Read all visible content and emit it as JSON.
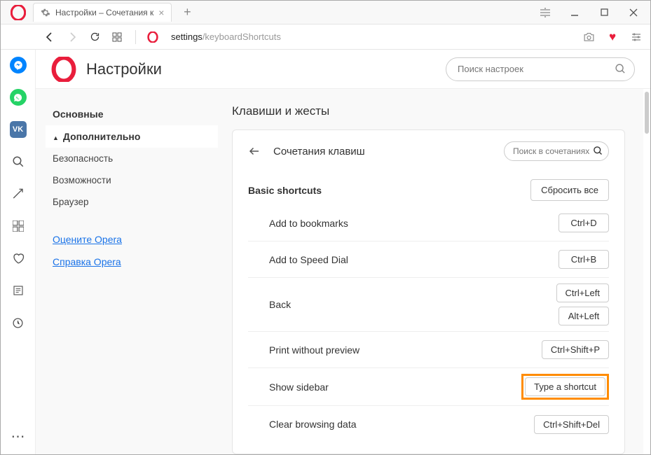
{
  "tab": {
    "title": "Настройки – Сочетания к"
  },
  "url": {
    "seg1": "settings",
    "seg2": "/keyboardShortcuts"
  },
  "header": {
    "title": "Настройки",
    "search_placeholder": "Поиск настроек"
  },
  "nav": {
    "basics": "Основные",
    "advanced": "Дополнительно",
    "security": "Безопасность",
    "features": "Возможности",
    "browser": "Браузер",
    "rate": "Оцените Opera",
    "help": "Справка Opera"
  },
  "panel": {
    "section": "Клавиши и жесты",
    "card_title": "Сочетания клавиш",
    "search_placeholder": "Поиск в сочетаниях..",
    "subhead": "Basic shortcuts",
    "reset": "Сбросить все",
    "rows": [
      {
        "label": "Add to bookmarks",
        "keys": [
          "Ctrl+D"
        ]
      },
      {
        "label": "Add to Speed Dial",
        "keys": [
          "Ctrl+B"
        ]
      },
      {
        "label": "Back",
        "keys": [
          "Ctrl+Left",
          "Alt+Left"
        ]
      },
      {
        "label": "Print without preview",
        "keys": [
          "Ctrl+Shift+P"
        ]
      },
      {
        "label": "Show sidebar",
        "keys": [
          "Type a shortcut"
        ],
        "highlight": true
      },
      {
        "label": "Clear browsing data",
        "keys": [
          "Ctrl+Shift+Del"
        ]
      }
    ]
  }
}
